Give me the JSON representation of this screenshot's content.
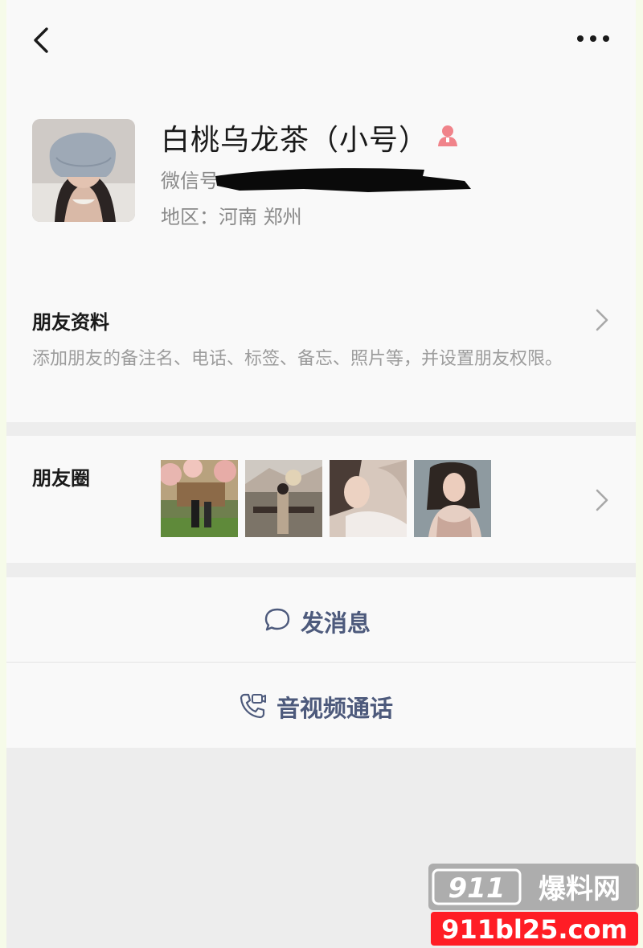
{
  "profile": {
    "nickname": "白桃乌龙茶（小号）",
    "wechat_id_label": "微信号",
    "region_label": "地区：河南 郑州"
  },
  "friend_info": {
    "title": "朋友资料",
    "description": "添加朋友的备注名、电话、标签、备忘、照片等，并设置朋友权限。"
  },
  "moments": {
    "title": "朋友圈"
  },
  "actions": {
    "send_message": "发消息",
    "av_call": "音视频通话"
  },
  "watermark": {
    "top_text": "911爆料网",
    "bottom_text": "911bl25.com"
  },
  "colors": {
    "action_text": "#4d5a7c",
    "gender_icon": "#f0838a",
    "watermark_red": "#ff1d25"
  }
}
